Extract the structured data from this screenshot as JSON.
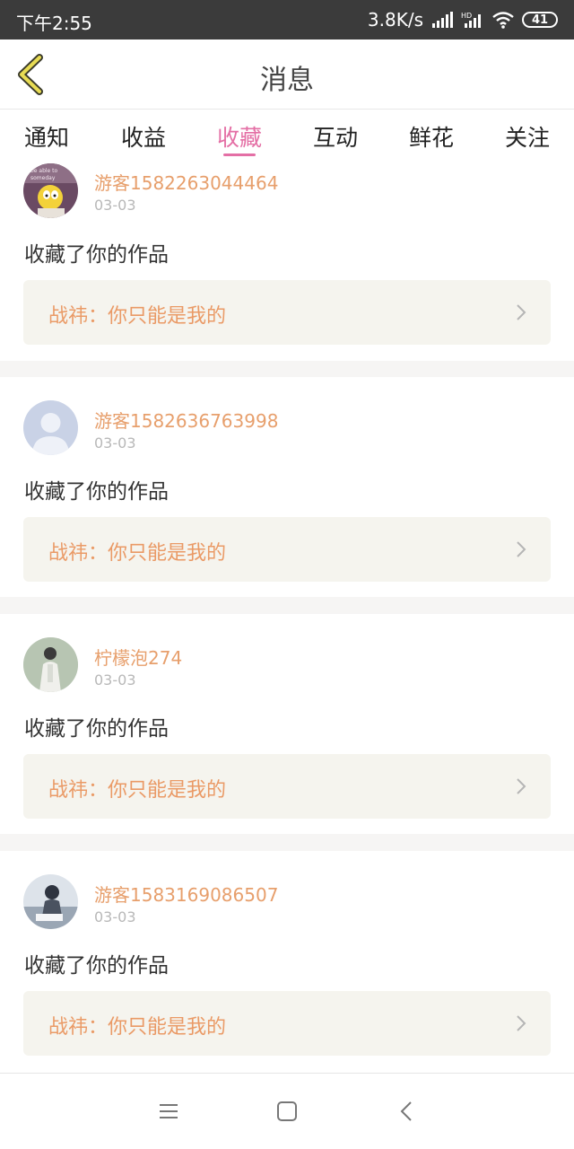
{
  "status": {
    "time": "下午2:55",
    "net_speed": "3.8K/s",
    "battery": "41"
  },
  "header": {
    "title": "消息"
  },
  "tabs": [
    {
      "label": "通知",
      "active": false
    },
    {
      "label": "收益",
      "active": false
    },
    {
      "label": "收藏",
      "active": true
    },
    {
      "label": "互动",
      "active": false
    },
    {
      "label": "鲜花",
      "active": false
    },
    {
      "label": "关注",
      "active": false
    }
  ],
  "colors": {
    "accent": "#e46fa5",
    "username": "#e79f6c",
    "work_title": "#ea9a66",
    "work_box_bg": "#f5f4ee"
  },
  "items": [
    {
      "username": "游客1582263044464",
      "date": "03-03",
      "action": "收藏了你的作品",
      "work": "战祎：你只能是我的",
      "avatar": "cartoon-avatar"
    },
    {
      "username": "游客1582636763998",
      "date": "03-03",
      "action": "收藏了你的作品",
      "work": "战祎：你只能是我的",
      "avatar": "default-avatar"
    },
    {
      "username": "柠檬泡274",
      "date": "03-03",
      "action": "收藏了你的作品",
      "work": "战祎：你只能是我的",
      "avatar": "photo-avatar"
    },
    {
      "username": "游客1583169086507",
      "date": "03-03",
      "action": "收藏了你的作品",
      "work": "战祎：你只能是我的",
      "avatar": "photo-avatar"
    }
  ]
}
